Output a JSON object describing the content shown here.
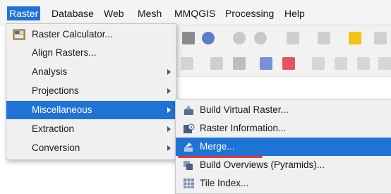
{
  "menubar": {
    "items": [
      {
        "label": "Raster"
      },
      {
        "label": "Database"
      },
      {
        "label": "Web"
      },
      {
        "label": "Mesh"
      },
      {
        "label": "MMQGIS"
      },
      {
        "label": "Processing"
      },
      {
        "label": "Help"
      }
    ]
  },
  "raster_menu": {
    "items": [
      {
        "label": "Raster Calculator...",
        "icon": "raster-calculator-icon"
      },
      {
        "label": "Align Rasters..."
      },
      {
        "label": "Analysis"
      },
      {
        "label": "Projections"
      },
      {
        "label": "Miscellaneous"
      },
      {
        "label": "Extraction"
      },
      {
        "label": "Conversion"
      }
    ]
  },
  "misc_submenu": {
    "items": [
      {
        "label": "Build Virtual Raster...",
        "icon": "build-virtual-raster-icon"
      },
      {
        "label": "Raster Information...",
        "icon": "raster-information-icon"
      },
      {
        "label": "Merge...",
        "icon": "merge-icon"
      },
      {
        "label": "Build Overviews (Pyramids)...",
        "icon": "build-overviews-icon"
      },
      {
        "label": "Tile Index...",
        "icon": "tile-index-icon"
      }
    ]
  },
  "colors": {
    "highlight": "#1f72d6",
    "annotation_underline": "#e53a2f"
  }
}
